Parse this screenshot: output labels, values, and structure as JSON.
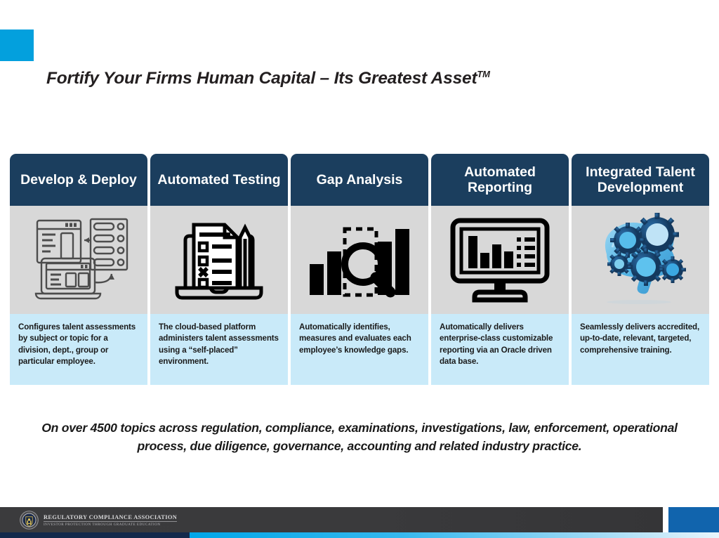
{
  "title": {
    "main": "Fortify Your Firms Human Capital – Its Greatest Asset",
    "trademark": "TM"
  },
  "colors": {
    "accent_blue": "#03a0dd",
    "header_navy": "#1b3e5e",
    "icon_panel_gray": "#d8d8d8",
    "caption_blue": "#c9eaf9",
    "footer_dark": "#3b3b3d",
    "footer_block_blue": "#1164ad",
    "strip_navy": "#13294b",
    "strip_cyan": "#00a6e8"
  },
  "columns": [
    {
      "header": "Develop & Deploy",
      "icon": "server-deploy-icon",
      "caption": "Configures talent assessments by subject or topic for a division, dept., group or particular employee."
    },
    {
      "header": "Automated Testing",
      "icon": "checklist-pencil-laptop-icon",
      "caption": "The cloud-based platform administers talent assessments using a “self-placed” environment."
    },
    {
      "header": "Gap Analysis",
      "icon": "bar-chart-magnifier-icon",
      "caption": "Automatically identifies, measures and evaluates each employee’s knowledge gaps."
    },
    {
      "header": "Automated Reporting",
      "icon": "monitor-report-icon",
      "caption": "Automatically delivers enterprise-class customizable reporting via an Oracle driven data base."
    },
    {
      "header": "Integrated Talent Development",
      "icon": "brain-gears-icon",
      "caption": "Seamlessly delivers accredited, up-to-date, relevant, targeted, comprehensive training."
    }
  ],
  "statement": "On over 4500 topics across regulation, compliance, examinations, investigations, law, enforcement, operational process, due diligence, governance, accounting and related industry practice.",
  "footer": {
    "logo_name": "REGULATORY COMPLIANCE ASSOCIATION",
    "logo_tagline": "INVESTOR PROTECTION THROUGH GRADUATE EDUCATION"
  }
}
